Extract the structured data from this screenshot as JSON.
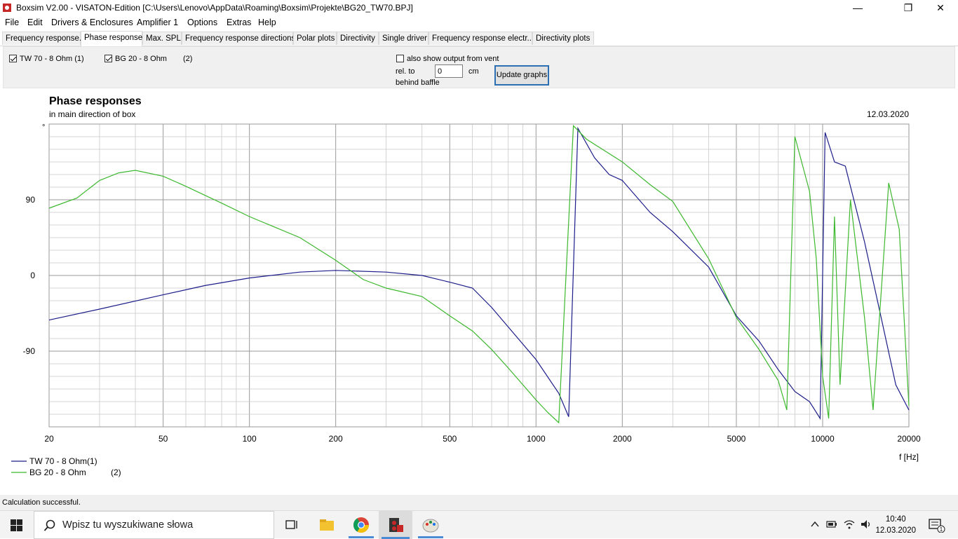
{
  "window": {
    "title": "Boxsim V2.00 - VISATON-Edition [C:\\Users\\Lenovo\\AppData\\Roaming\\Boxsim\\Projekte\\BG20_TW70.BPJ]",
    "minimize": "—",
    "maximize": "❐",
    "close": "✕"
  },
  "menu": [
    "File",
    "Edit",
    "Drivers & Enclosures",
    "Amplifier 1",
    "Options",
    "Extras",
    "Help"
  ],
  "tabs": [
    "Frequency response.",
    "Phase response",
    "Max. SPL",
    "Frequency response directions",
    "Polar plots",
    "Directivity",
    "Single driver",
    "Frequency response electr..",
    "Directivity plots"
  ],
  "active_tab": "Phase response",
  "controls": {
    "driver1_label": "TW 70 - 8 Ohm (1)",
    "driver2_label": "BG 20 - 8 Ohm",
    "driver2_num": "(2)",
    "vent_label": "also show output from vent",
    "rel_to": "rel. to",
    "behind_baffle": "behind baffle",
    "vent_value": "0",
    "vent_unit": "cm",
    "update_button": "Update graphs"
  },
  "chart_data": {
    "type": "line",
    "title": "Phase responses",
    "subtitle": "in main direction of box",
    "date": "12.03.2020",
    "ylabel": "°",
    "xlabel": "f [Hz]",
    "x_scale": "log",
    "xlim": [
      20,
      20000
    ],
    "ylim": [
      -180,
      180
    ],
    "x_ticks": [
      20,
      50,
      100,
      200,
      500,
      1000,
      2000,
      5000,
      10000,
      20000
    ],
    "y_ticks": [
      90,
      0,
      -90
    ],
    "grid": true,
    "legend_position": "bottom-left",
    "series": [
      {
        "name": "TW 70 - 8 Ohm(1)",
        "color": "#1c1c8a",
        "points": [
          [
            20,
            -53
          ],
          [
            30,
            -40
          ],
          [
            50,
            -23
          ],
          [
            70,
            -12
          ],
          [
            100,
            -3
          ],
          [
            150,
            4
          ],
          [
            200,
            6
          ],
          [
            300,
            4
          ],
          [
            400,
            0
          ],
          [
            500,
            -8
          ],
          [
            600,
            -15
          ],
          [
            700,
            -38
          ],
          [
            1000,
            -100
          ],
          [
            1200,
            -140
          ],
          [
            1300,
            -168
          ],
          [
            1400,
            175
          ],
          [
            1600,
            140
          ],
          [
            1800,
            120
          ],
          [
            2000,
            113
          ],
          [
            2500,
            75
          ],
          [
            3000,
            52
          ],
          [
            4000,
            10
          ],
          [
            5000,
            -48
          ],
          [
            6000,
            -78
          ],
          [
            7000,
            -112
          ],
          [
            8000,
            -138
          ],
          [
            9000,
            -150
          ],
          [
            9800,
            -170
          ],
          [
            10200,
            170
          ],
          [
            11000,
            135
          ],
          [
            12000,
            130
          ],
          [
            14000,
            40
          ],
          [
            16000,
            -50
          ],
          [
            18000,
            -130
          ],
          [
            20000,
            -160
          ]
        ]
      },
      {
        "name": "BG 20 - 8 Ohm",
        "label_suffix": "(2)",
        "color": "#3cb82d",
        "points": [
          [
            20,
            80
          ],
          [
            25,
            92
          ],
          [
            30,
            113
          ],
          [
            35,
            122
          ],
          [
            40,
            125
          ],
          [
            50,
            118
          ],
          [
            60,
            106
          ],
          [
            80,
            86
          ],
          [
            100,
            70
          ],
          [
            150,
            45
          ],
          [
            200,
            18
          ],
          [
            250,
            -5
          ],
          [
            300,
            -15
          ],
          [
            400,
            -25
          ],
          [
            500,
            -48
          ],
          [
            600,
            -66
          ],
          [
            700,
            -88
          ],
          [
            800,
            -110
          ],
          [
            900,
            -130
          ],
          [
            1000,
            -148
          ],
          [
            1100,
            -163
          ],
          [
            1200,
            -175
          ],
          [
            1350,
            178
          ],
          [
            1500,
            162
          ],
          [
            2000,
            135
          ],
          [
            2500,
            108
          ],
          [
            3000,
            88
          ],
          [
            4000,
            20
          ],
          [
            5000,
            -50
          ],
          [
            6000,
            -88
          ],
          [
            7000,
            -125
          ],
          [
            7500,
            -160
          ],
          [
            8000,
            165
          ],
          [
            9000,
            100
          ],
          [
            9500,
            20
          ],
          [
            10000,
            -120
          ],
          [
            10500,
            -170
          ],
          [
            11000,
            70
          ],
          [
            11500,
            -130
          ],
          [
            12500,
            90
          ],
          [
            14000,
            -50
          ],
          [
            15000,
            -160
          ],
          [
            17000,
            110
          ],
          [
            18500,
            55
          ],
          [
            20000,
            -155
          ]
        ]
      }
    ]
  },
  "status": "Calculation successful.",
  "taskbar": {
    "search_placeholder": "Wpisz tu wyszukiwane słowa",
    "time": "10:40",
    "date": "12.03.2020",
    "notif_count": "1"
  }
}
